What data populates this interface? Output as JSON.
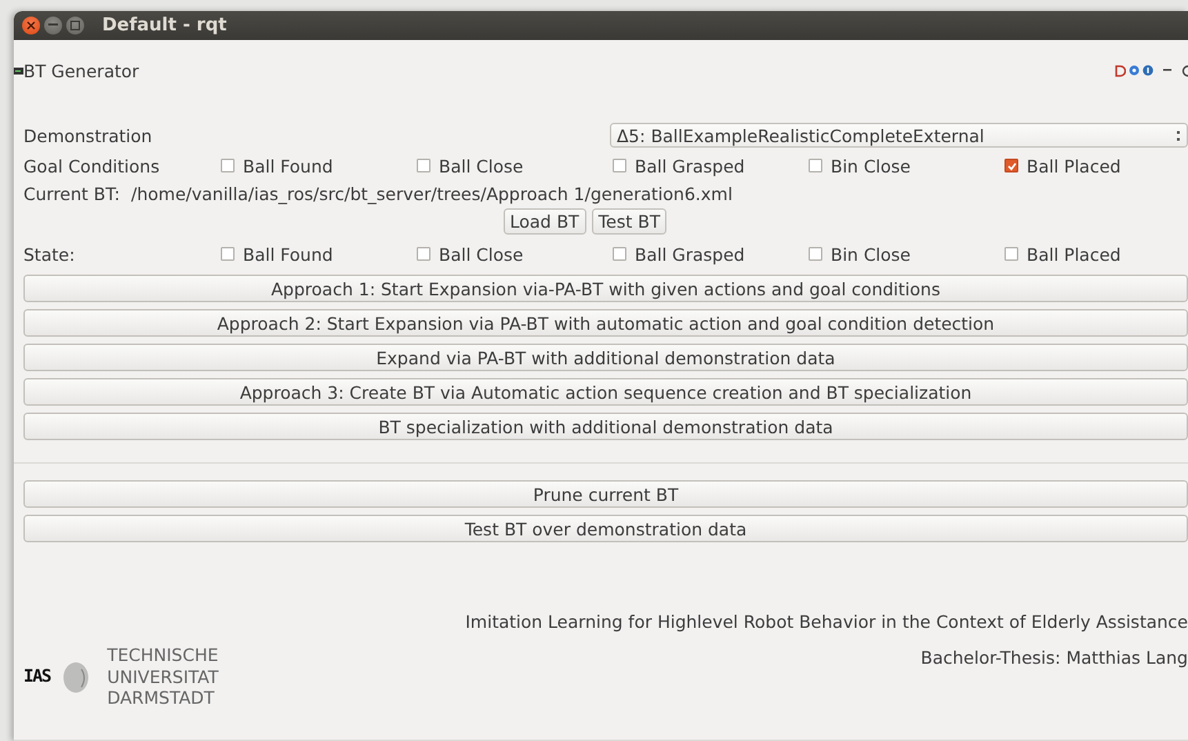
{
  "window": {
    "title": "Default - rqt"
  },
  "plugin": {
    "title": "BT Generator"
  },
  "demonstration": {
    "label": "Demonstration",
    "value": "Δ5: BallExampleRealisticCompleteExternal"
  },
  "goal_conditions": {
    "label": "Goal Conditions",
    "items": [
      {
        "label": "Ball Found",
        "checked": false
      },
      {
        "label": "Ball Close",
        "checked": false
      },
      {
        "label": "Ball Grasped",
        "checked": false
      },
      {
        "label": "Bin Close",
        "checked": false
      },
      {
        "label": "Ball Placed",
        "checked": true
      }
    ]
  },
  "current_bt": {
    "label": "Current BT:",
    "path": "/home/vanilla/ias_ros/src/bt_server/trees/Approach 1/generation6.xml"
  },
  "bt_buttons": [
    "Load BT",
    "Test BT"
  ],
  "state": {
    "label": "State:",
    "items": [
      {
        "label": "Ball Found",
        "checked": false
      },
      {
        "label": "Ball Close",
        "checked": false
      },
      {
        "label": "Ball Grasped",
        "checked": false
      },
      {
        "label": "Bin Close",
        "checked": false
      },
      {
        "label": "Ball Placed",
        "checked": false
      }
    ]
  },
  "actions": [
    "Approach 1: Start Expansion via-PA-BT with given actions and goal conditions",
    "Approach 2: Start Expansion via PA-BT with automatic action and goal condition detection",
    "Expand via PA-BT with additional demonstration data",
    "Approach 3: Create BT via Automatic action sequence creation and BT specialization",
    "BT specialization with additional demonstration data"
  ],
  "tools": [
    "Prune current BT",
    "Test BT over demonstration data"
  ],
  "footer": {
    "title": "Imitation Learning for Highlevel Robot Behavior in the Context of Elderly Assistance",
    "author": "Bachelor-Thesis: Matthias Lang",
    "ias_logo": "IAS",
    "university_logo": [
      "TECHNISCHE",
      "UNIVERSITAT",
      "DARMSTADT"
    ]
  }
}
